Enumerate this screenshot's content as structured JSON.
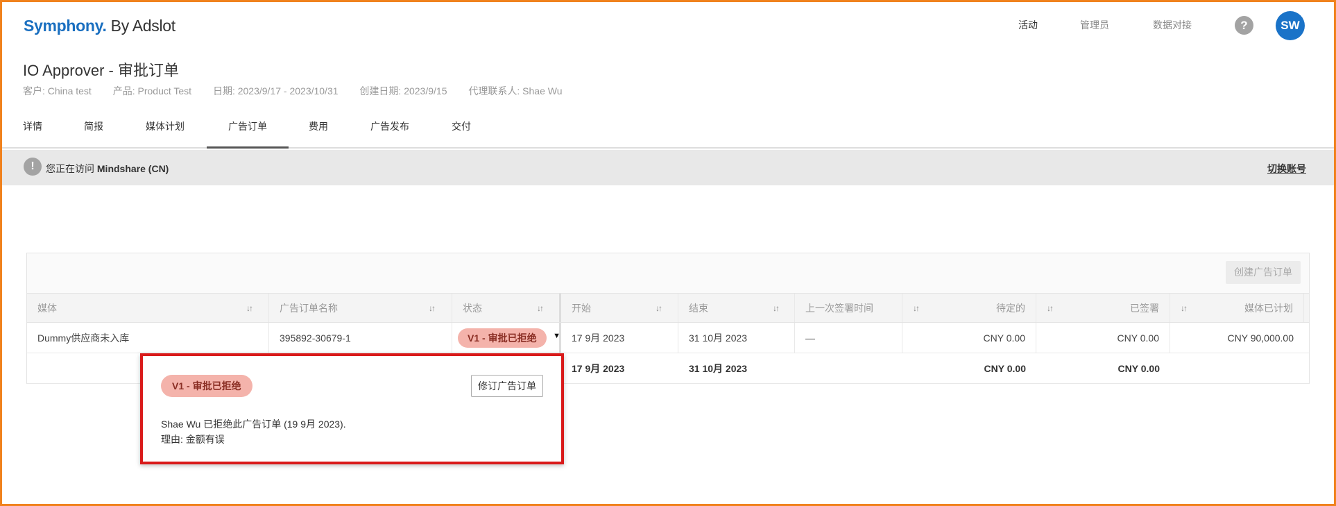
{
  "header": {
    "logo_brand": "Symphony.",
    "logo_suffix": " By Adslot",
    "nav": [
      "活动",
      "管理员",
      "数据对接"
    ],
    "help_label": "?",
    "avatar_initials": "SW"
  },
  "page": {
    "title": "IO Approver - 审批订单",
    "meta": {
      "client": "客户: China test",
      "product": "产品: Product Test",
      "dates": "日期: 2023/9/17 - 2023/10/31",
      "created": "创建日期: 2023/9/15",
      "agent": "代理联系人: Shae Wu"
    }
  },
  "tabs": [
    "详情",
    "简报",
    "媒体计划",
    "广告订单",
    "费用",
    "广告发布",
    "交付"
  ],
  "active_tab": "广告订单",
  "banner": {
    "icon": "!",
    "prefix": "您正在访问 ",
    "account": "Mindshare (CN)",
    "switch_label": "切换账号"
  },
  "table": {
    "create_button": "创建广告订单",
    "sort_glyph": "↓↑",
    "headers": [
      "媒体",
      "广告订单名称",
      "状态",
      "开始",
      "结束",
      "上一次签署时间",
      "待定的",
      "已签署",
      "媒体已计划"
    ],
    "rows": [
      {
        "media": "Dummy供应商未入库",
        "io_name": "395892-30679-1",
        "status": "V1 - 审批已拒绝",
        "start": "17 9月 2023",
        "end": "31 10月 2023",
        "last_signed": "—",
        "pending": "CNY 0.00",
        "signed": "CNY 0.00",
        "planned": "CNY 90,000.00"
      }
    ],
    "totals": {
      "start": "17 9月 2023",
      "end": "31 10月 2023",
      "pending": "CNY 0.00",
      "signed": "CNY 0.00"
    }
  },
  "popover": {
    "status": "V1 - 审批已拒绝",
    "revise_button": "修订广告订单",
    "message": "Shae Wu 已拒绝此广告订单 (19 9月 2023).",
    "reason": "理由: 金额有误"
  },
  "colors": {
    "brand": "#1a6fc0",
    "avatar": "#1a73c8",
    "status_pill_bg": "#f4b3ab",
    "highlight_border": "#d91a1a",
    "frame_border": "#f0821e"
  }
}
